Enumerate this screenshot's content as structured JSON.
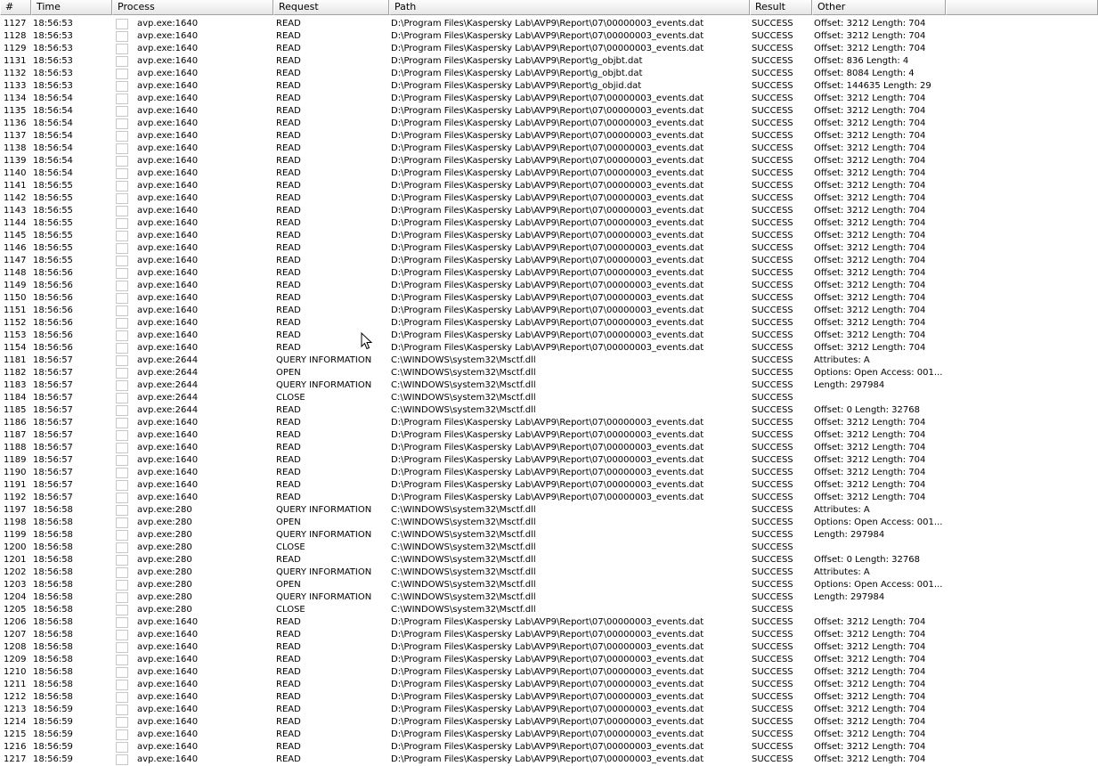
{
  "columns": {
    "seq": "#",
    "time": "Time",
    "process": "Process",
    "request": "Request",
    "path": "Path",
    "result": "Result",
    "other": "Other"
  },
  "rows": [
    {
      "seq": "1127",
      "time": "18:56:53",
      "process": "avp.exe:1640",
      "request": "READ",
      "path": "D:\\Program Files\\Kaspersky Lab\\AVP9\\Report\\07\\00000003_events.dat",
      "result": "SUCCESS",
      "other": "Offset: 3212 Length: 704"
    },
    {
      "seq": "1128",
      "time": "18:56:53",
      "process": "avp.exe:1640",
      "request": "READ",
      "path": "D:\\Program Files\\Kaspersky Lab\\AVP9\\Report\\07\\00000003_events.dat",
      "result": "SUCCESS",
      "other": "Offset: 3212 Length: 704"
    },
    {
      "seq": "1129",
      "time": "18:56:53",
      "process": "avp.exe:1640",
      "request": "READ",
      "path": "D:\\Program Files\\Kaspersky Lab\\AVP9\\Report\\07\\00000003_events.dat",
      "result": "SUCCESS",
      "other": "Offset: 3212 Length: 704"
    },
    {
      "seq": "1131",
      "time": "18:56:53",
      "process": "avp.exe:1640",
      "request": "READ",
      "path": "D:\\Program Files\\Kaspersky Lab\\AVP9\\Report\\g_objbt.dat",
      "result": "SUCCESS",
      "other": "Offset: 836 Length: 4"
    },
    {
      "seq": "1132",
      "time": "18:56:53",
      "process": "avp.exe:1640",
      "request": "READ",
      "path": "D:\\Program Files\\Kaspersky Lab\\AVP9\\Report\\g_objbt.dat",
      "result": "SUCCESS",
      "other": "Offset: 8084 Length: 4"
    },
    {
      "seq": "1133",
      "time": "18:56:53",
      "process": "avp.exe:1640",
      "request": "READ",
      "path": "D:\\Program Files\\Kaspersky Lab\\AVP9\\Report\\g_objid.dat",
      "result": "SUCCESS",
      "other": "Offset: 144635 Length: 29"
    },
    {
      "seq": "1134",
      "time": "18:56:54",
      "process": "avp.exe:1640",
      "request": "READ",
      "path": "D:\\Program Files\\Kaspersky Lab\\AVP9\\Report\\07\\00000003_events.dat",
      "result": "SUCCESS",
      "other": "Offset: 3212 Length: 704"
    },
    {
      "seq": "1135",
      "time": "18:56:54",
      "process": "avp.exe:1640",
      "request": "READ",
      "path": "D:\\Program Files\\Kaspersky Lab\\AVP9\\Report\\07\\00000003_events.dat",
      "result": "SUCCESS",
      "other": "Offset: 3212 Length: 704"
    },
    {
      "seq": "1136",
      "time": "18:56:54",
      "process": "avp.exe:1640",
      "request": "READ",
      "path": "D:\\Program Files\\Kaspersky Lab\\AVP9\\Report\\07\\00000003_events.dat",
      "result": "SUCCESS",
      "other": "Offset: 3212 Length: 704"
    },
    {
      "seq": "1137",
      "time": "18:56:54",
      "process": "avp.exe:1640",
      "request": "READ",
      "path": "D:\\Program Files\\Kaspersky Lab\\AVP9\\Report\\07\\00000003_events.dat",
      "result": "SUCCESS",
      "other": "Offset: 3212 Length: 704"
    },
    {
      "seq": "1138",
      "time": "18:56:54",
      "process": "avp.exe:1640",
      "request": "READ",
      "path": "D:\\Program Files\\Kaspersky Lab\\AVP9\\Report\\07\\00000003_events.dat",
      "result": "SUCCESS",
      "other": "Offset: 3212 Length: 704"
    },
    {
      "seq": "1139",
      "time": "18:56:54",
      "process": "avp.exe:1640",
      "request": "READ",
      "path": "D:\\Program Files\\Kaspersky Lab\\AVP9\\Report\\07\\00000003_events.dat",
      "result": "SUCCESS",
      "other": "Offset: 3212 Length: 704"
    },
    {
      "seq": "1140",
      "time": "18:56:54",
      "process": "avp.exe:1640",
      "request": "READ",
      "path": "D:\\Program Files\\Kaspersky Lab\\AVP9\\Report\\07\\00000003_events.dat",
      "result": "SUCCESS",
      "other": "Offset: 3212 Length: 704"
    },
    {
      "seq": "1141",
      "time": "18:56:55",
      "process": "avp.exe:1640",
      "request": "READ",
      "path": "D:\\Program Files\\Kaspersky Lab\\AVP9\\Report\\07\\00000003_events.dat",
      "result": "SUCCESS",
      "other": "Offset: 3212 Length: 704"
    },
    {
      "seq": "1142",
      "time": "18:56:55",
      "process": "avp.exe:1640",
      "request": "READ",
      "path": "D:\\Program Files\\Kaspersky Lab\\AVP9\\Report\\07\\00000003_events.dat",
      "result": "SUCCESS",
      "other": "Offset: 3212 Length: 704"
    },
    {
      "seq": "1143",
      "time": "18:56:55",
      "process": "avp.exe:1640",
      "request": "READ",
      "path": "D:\\Program Files\\Kaspersky Lab\\AVP9\\Report\\07\\00000003_events.dat",
      "result": "SUCCESS",
      "other": "Offset: 3212 Length: 704"
    },
    {
      "seq": "1144",
      "time": "18:56:55",
      "process": "avp.exe:1640",
      "request": "READ",
      "path": "D:\\Program Files\\Kaspersky Lab\\AVP9\\Report\\07\\00000003_events.dat",
      "result": "SUCCESS",
      "other": "Offset: 3212 Length: 704"
    },
    {
      "seq": "1145",
      "time": "18:56:55",
      "process": "avp.exe:1640",
      "request": "READ",
      "path": "D:\\Program Files\\Kaspersky Lab\\AVP9\\Report\\07\\00000003_events.dat",
      "result": "SUCCESS",
      "other": "Offset: 3212 Length: 704"
    },
    {
      "seq": "1146",
      "time": "18:56:55",
      "process": "avp.exe:1640",
      "request": "READ",
      "path": "D:\\Program Files\\Kaspersky Lab\\AVP9\\Report\\07\\00000003_events.dat",
      "result": "SUCCESS",
      "other": "Offset: 3212 Length: 704"
    },
    {
      "seq": "1147",
      "time": "18:56:55",
      "process": "avp.exe:1640",
      "request": "READ",
      "path": "D:\\Program Files\\Kaspersky Lab\\AVP9\\Report\\07\\00000003_events.dat",
      "result": "SUCCESS",
      "other": "Offset: 3212 Length: 704"
    },
    {
      "seq": "1148",
      "time": "18:56:56",
      "process": "avp.exe:1640",
      "request": "READ",
      "path": "D:\\Program Files\\Kaspersky Lab\\AVP9\\Report\\07\\00000003_events.dat",
      "result": "SUCCESS",
      "other": "Offset: 3212 Length: 704"
    },
    {
      "seq": "1149",
      "time": "18:56:56",
      "process": "avp.exe:1640",
      "request": "READ",
      "path": "D:\\Program Files\\Kaspersky Lab\\AVP9\\Report\\07\\00000003_events.dat",
      "result": "SUCCESS",
      "other": "Offset: 3212 Length: 704"
    },
    {
      "seq": "1150",
      "time": "18:56:56",
      "process": "avp.exe:1640",
      "request": "READ",
      "path": "D:\\Program Files\\Kaspersky Lab\\AVP9\\Report\\07\\00000003_events.dat",
      "result": "SUCCESS",
      "other": "Offset: 3212 Length: 704"
    },
    {
      "seq": "1151",
      "time": "18:56:56",
      "process": "avp.exe:1640",
      "request": "READ",
      "path": "D:\\Program Files\\Kaspersky Lab\\AVP9\\Report\\07\\00000003_events.dat",
      "result": "SUCCESS",
      "other": "Offset: 3212 Length: 704"
    },
    {
      "seq": "1152",
      "time": "18:56:56",
      "process": "avp.exe:1640",
      "request": "READ",
      "path": "D:\\Program Files\\Kaspersky Lab\\AVP9\\Report\\07\\00000003_events.dat",
      "result": "SUCCESS",
      "other": "Offset: 3212 Length: 704"
    },
    {
      "seq": "1153",
      "time": "18:56:56",
      "process": "avp.exe:1640",
      "request": "READ",
      "path": "D:\\Program Files\\Kaspersky Lab\\AVP9\\Report\\07\\00000003_events.dat",
      "result": "SUCCESS",
      "other": "Offset: 3212 Length: 704"
    },
    {
      "seq": "1154",
      "time": "18:56:56",
      "process": "avp.exe:1640",
      "request": "READ",
      "path": "D:\\Program Files\\Kaspersky Lab\\AVP9\\Report\\07\\00000003_events.dat",
      "result": "SUCCESS",
      "other": "Offset: 3212 Length: 704"
    },
    {
      "seq": "1181",
      "time": "18:56:57",
      "process": "avp.exe:2644",
      "request": "QUERY INFORMATION",
      "path": "C:\\WINDOWS\\system32\\Msctf.dll",
      "result": "SUCCESS",
      "other": "Attributes: A"
    },
    {
      "seq": "1182",
      "time": "18:56:57",
      "process": "avp.exe:2644",
      "request": "OPEN",
      "path": "C:\\WINDOWS\\system32\\Msctf.dll",
      "result": "SUCCESS",
      "other": "Options: Open  Access: 001..."
    },
    {
      "seq": "1183",
      "time": "18:56:57",
      "process": "avp.exe:2644",
      "request": "QUERY INFORMATION",
      "path": "C:\\WINDOWS\\system32\\Msctf.dll",
      "result": "SUCCESS",
      "other": "Length: 297984"
    },
    {
      "seq": "1184",
      "time": "18:56:57",
      "process": "avp.exe:2644",
      "request": "CLOSE",
      "path": "C:\\WINDOWS\\system32\\Msctf.dll",
      "result": "SUCCESS",
      "other": ""
    },
    {
      "seq": "1185",
      "time": "18:56:57",
      "process": "avp.exe:2644",
      "request": "READ",
      "path": "C:\\WINDOWS\\system32\\Msctf.dll",
      "result": "SUCCESS",
      "other": "Offset: 0 Length: 32768"
    },
    {
      "seq": "1186",
      "time": "18:56:57",
      "process": "avp.exe:1640",
      "request": "READ",
      "path": "D:\\Program Files\\Kaspersky Lab\\AVP9\\Report\\07\\00000003_events.dat",
      "result": "SUCCESS",
      "other": "Offset: 3212 Length: 704"
    },
    {
      "seq": "1187",
      "time": "18:56:57",
      "process": "avp.exe:1640",
      "request": "READ",
      "path": "D:\\Program Files\\Kaspersky Lab\\AVP9\\Report\\07\\00000003_events.dat",
      "result": "SUCCESS",
      "other": "Offset: 3212 Length: 704"
    },
    {
      "seq": "1188",
      "time": "18:56:57",
      "process": "avp.exe:1640",
      "request": "READ",
      "path": "D:\\Program Files\\Kaspersky Lab\\AVP9\\Report\\07\\00000003_events.dat",
      "result": "SUCCESS",
      "other": "Offset: 3212 Length: 704"
    },
    {
      "seq": "1189",
      "time": "18:56:57",
      "process": "avp.exe:1640",
      "request": "READ",
      "path": "D:\\Program Files\\Kaspersky Lab\\AVP9\\Report\\07\\00000003_events.dat",
      "result": "SUCCESS",
      "other": "Offset: 3212 Length: 704"
    },
    {
      "seq": "1190",
      "time": "18:56:57",
      "process": "avp.exe:1640",
      "request": "READ",
      "path": "D:\\Program Files\\Kaspersky Lab\\AVP9\\Report\\07\\00000003_events.dat",
      "result": "SUCCESS",
      "other": "Offset: 3212 Length: 704"
    },
    {
      "seq": "1191",
      "time": "18:56:57",
      "process": "avp.exe:1640",
      "request": "READ",
      "path": "D:\\Program Files\\Kaspersky Lab\\AVP9\\Report\\07\\00000003_events.dat",
      "result": "SUCCESS",
      "other": "Offset: 3212 Length: 704"
    },
    {
      "seq": "1192",
      "time": "18:56:57",
      "process": "avp.exe:1640",
      "request": "READ",
      "path": "D:\\Program Files\\Kaspersky Lab\\AVP9\\Report\\07\\00000003_events.dat",
      "result": "SUCCESS",
      "other": "Offset: 3212 Length: 704"
    },
    {
      "seq": "1197",
      "time": "18:56:58",
      "process": "avp.exe:280",
      "request": "QUERY INFORMATION",
      "path": "C:\\WINDOWS\\system32\\Msctf.dll",
      "result": "SUCCESS",
      "other": "Attributes: A"
    },
    {
      "seq": "1198",
      "time": "18:56:58",
      "process": "avp.exe:280",
      "request": "OPEN",
      "path": "C:\\WINDOWS\\system32\\Msctf.dll",
      "result": "SUCCESS",
      "other": "Options: Open  Access: 001..."
    },
    {
      "seq": "1199",
      "time": "18:56:58",
      "process": "avp.exe:280",
      "request": "QUERY INFORMATION",
      "path": "C:\\WINDOWS\\system32\\Msctf.dll",
      "result": "SUCCESS",
      "other": "Length: 297984"
    },
    {
      "seq": "1200",
      "time": "18:56:58",
      "process": "avp.exe:280",
      "request": "CLOSE",
      "path": "C:\\WINDOWS\\system32\\Msctf.dll",
      "result": "SUCCESS",
      "other": ""
    },
    {
      "seq": "1201",
      "time": "18:56:58",
      "process": "avp.exe:280",
      "request": "READ",
      "path": "C:\\WINDOWS\\system32\\Msctf.dll",
      "result": "SUCCESS",
      "other": "Offset: 0 Length: 32768"
    },
    {
      "seq": "1202",
      "time": "18:56:58",
      "process": "avp.exe:280",
      "request": "QUERY INFORMATION",
      "path": "C:\\WINDOWS\\system32\\Msctf.dll",
      "result": "SUCCESS",
      "other": "Attributes: A"
    },
    {
      "seq": "1203",
      "time": "18:56:58",
      "process": "avp.exe:280",
      "request": "OPEN",
      "path": "C:\\WINDOWS\\system32\\Msctf.dll",
      "result": "SUCCESS",
      "other": "Options: Open  Access: 001..."
    },
    {
      "seq": "1204",
      "time": "18:56:58",
      "process": "avp.exe:280",
      "request": "QUERY INFORMATION",
      "path": "C:\\WINDOWS\\system32\\Msctf.dll",
      "result": "SUCCESS",
      "other": "Length: 297984"
    },
    {
      "seq": "1205",
      "time": "18:56:58",
      "process": "avp.exe:280",
      "request": "CLOSE",
      "path": "C:\\WINDOWS\\system32\\Msctf.dll",
      "result": "SUCCESS",
      "other": ""
    },
    {
      "seq": "1206",
      "time": "18:56:58",
      "process": "avp.exe:1640",
      "request": "READ",
      "path": "D:\\Program Files\\Kaspersky Lab\\AVP9\\Report\\07\\00000003_events.dat",
      "result": "SUCCESS",
      "other": "Offset: 3212 Length: 704"
    },
    {
      "seq": "1207",
      "time": "18:56:58",
      "process": "avp.exe:1640",
      "request": "READ",
      "path": "D:\\Program Files\\Kaspersky Lab\\AVP9\\Report\\07\\00000003_events.dat",
      "result": "SUCCESS",
      "other": "Offset: 3212 Length: 704"
    },
    {
      "seq": "1208",
      "time": "18:56:58",
      "process": "avp.exe:1640",
      "request": "READ",
      "path": "D:\\Program Files\\Kaspersky Lab\\AVP9\\Report\\07\\00000003_events.dat",
      "result": "SUCCESS",
      "other": "Offset: 3212 Length: 704"
    },
    {
      "seq": "1209",
      "time": "18:56:58",
      "process": "avp.exe:1640",
      "request": "READ",
      "path": "D:\\Program Files\\Kaspersky Lab\\AVP9\\Report\\07\\00000003_events.dat",
      "result": "SUCCESS",
      "other": "Offset: 3212 Length: 704"
    },
    {
      "seq": "1210",
      "time": "18:56:58",
      "process": "avp.exe:1640",
      "request": "READ",
      "path": "D:\\Program Files\\Kaspersky Lab\\AVP9\\Report\\07\\00000003_events.dat",
      "result": "SUCCESS",
      "other": "Offset: 3212 Length: 704"
    },
    {
      "seq": "1211",
      "time": "18:56:58",
      "process": "avp.exe:1640",
      "request": "READ",
      "path": "D:\\Program Files\\Kaspersky Lab\\AVP9\\Report\\07\\00000003_events.dat",
      "result": "SUCCESS",
      "other": "Offset: 3212 Length: 704"
    },
    {
      "seq": "1212",
      "time": "18:56:58",
      "process": "avp.exe:1640",
      "request": "READ",
      "path": "D:\\Program Files\\Kaspersky Lab\\AVP9\\Report\\07\\00000003_events.dat",
      "result": "SUCCESS",
      "other": "Offset: 3212 Length: 704"
    },
    {
      "seq": "1213",
      "time": "18:56:59",
      "process": "avp.exe:1640",
      "request": "READ",
      "path": "D:\\Program Files\\Kaspersky Lab\\AVP9\\Report\\07\\00000003_events.dat",
      "result": "SUCCESS",
      "other": "Offset: 3212 Length: 704"
    },
    {
      "seq": "1214",
      "time": "18:56:59",
      "process": "avp.exe:1640",
      "request": "READ",
      "path": "D:\\Program Files\\Kaspersky Lab\\AVP9\\Report\\07\\00000003_events.dat",
      "result": "SUCCESS",
      "other": "Offset: 3212 Length: 704"
    },
    {
      "seq": "1215",
      "time": "18:56:59",
      "process": "avp.exe:1640",
      "request": "READ",
      "path": "D:\\Program Files\\Kaspersky Lab\\AVP9\\Report\\07\\00000003_events.dat",
      "result": "SUCCESS",
      "other": "Offset: 3212 Length: 704"
    },
    {
      "seq": "1216",
      "time": "18:56:59",
      "process": "avp.exe:1640",
      "request": "READ",
      "path": "D:\\Program Files\\Kaspersky Lab\\AVP9\\Report\\07\\00000003_events.dat",
      "result": "SUCCESS",
      "other": "Offset: 3212 Length: 704"
    },
    {
      "seq": "1217",
      "time": "18:56:59",
      "process": "avp.exe:1640",
      "request": "READ",
      "path": "D:\\Program Files\\Kaspersky Lab\\AVP9\\Report\\07\\00000003_events.dat",
      "result": "SUCCESS",
      "other": "Offset: 3212 Length: 704"
    }
  ],
  "icons": {
    "process": "process-icon",
    "cursor": "mouse-pointer-icon"
  }
}
